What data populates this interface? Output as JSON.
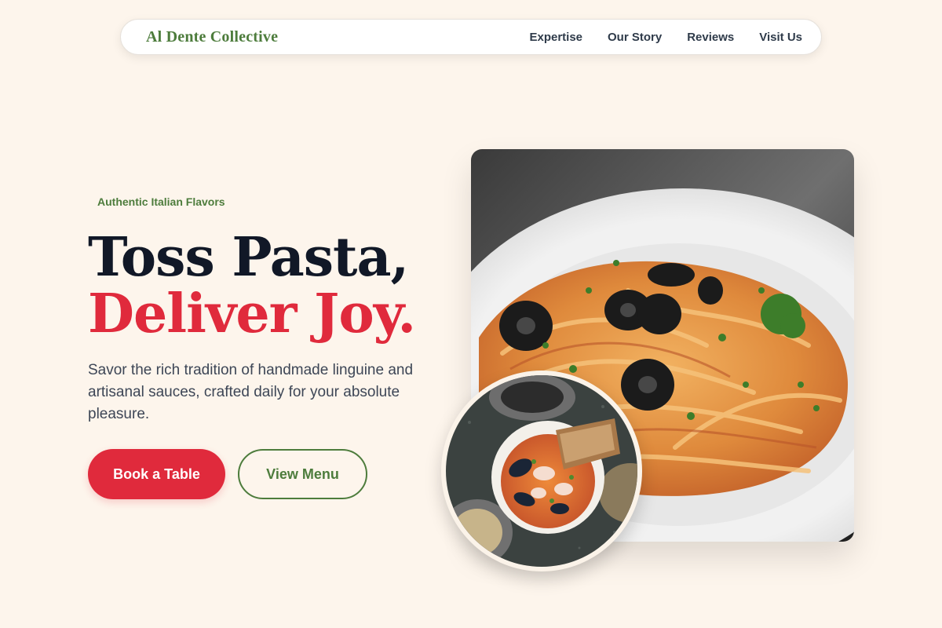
{
  "nav": {
    "brand": "Al Dente Collective",
    "links": [
      "Expertise",
      "Our Story",
      "Reviews",
      "Visit Us"
    ]
  },
  "hero": {
    "eyebrow": "Authentic Italian Flavors",
    "headline_line1": "Toss Pasta,",
    "headline_line2": "Deliver Joy.",
    "subtitle": "Savor the rich tradition of handmade linguine and artisanal sauces, crafted daily for your absolute pleasure.",
    "primary_cta": "Book a Table",
    "secondary_cta": "View Menu"
  },
  "colors": {
    "background": "#fdf5ec",
    "brand_green": "#4d7c3c",
    "accent_red": "#e02a3c",
    "headline_dark": "#111827"
  },
  "images": {
    "main": "pasta-with-olives-photo",
    "inset": "seafood-stew-photo"
  }
}
